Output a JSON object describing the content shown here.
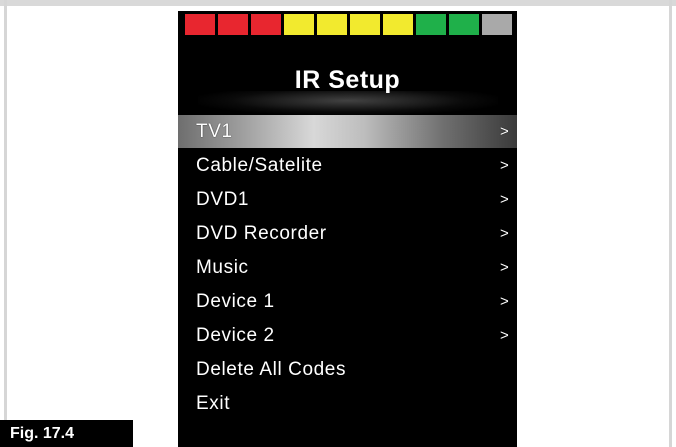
{
  "figure": {
    "label": "Fig. 17.4"
  },
  "screen": {
    "level_bar": [
      {
        "color": "#e8262f"
      },
      {
        "color": "#e8262f"
      },
      {
        "color": "#e8262f"
      },
      {
        "color": "#f2ea2e"
      },
      {
        "color": "#f2ea2e"
      },
      {
        "color": "#f2ea2e"
      },
      {
        "color": "#f2ea2e"
      },
      {
        "color": "#1fb04a"
      },
      {
        "color": "#1fb04a"
      },
      {
        "color": "#a9a9a9"
      }
    ],
    "title": "IR Setup",
    "menu": [
      {
        "label": "TV1",
        "arrow": ">",
        "selected": true
      },
      {
        "label": "Cable/Satelite",
        "arrow": ">"
      },
      {
        "label": "DVD1",
        "arrow": ">"
      },
      {
        "label": "DVD Recorder",
        "arrow": ">"
      },
      {
        "label": "Music",
        "arrow": ">"
      },
      {
        "label": "Device 1",
        "arrow": ">"
      },
      {
        "label": "Device 2",
        "arrow": ">"
      },
      {
        "label": "Delete All Codes",
        "arrow": ""
      },
      {
        "label": "Exit",
        "arrow": ""
      }
    ]
  }
}
